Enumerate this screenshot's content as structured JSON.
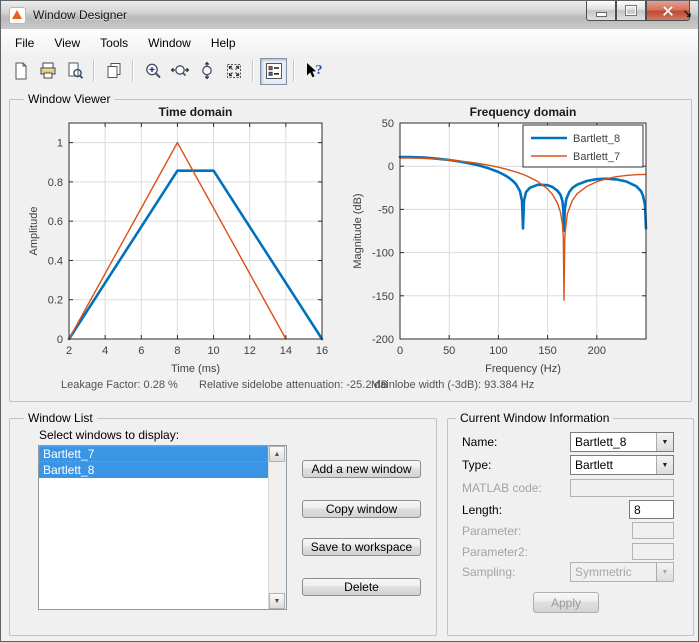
{
  "window": {
    "title": "Window Designer"
  },
  "menu": {
    "items": [
      "File",
      "View",
      "Tools",
      "Window",
      "Help"
    ]
  },
  "toolbar": {
    "icons": [
      "new-document",
      "print",
      "print-preview",
      "copy-window",
      "zoom-in",
      "zoom-x",
      "zoom-y",
      "full-view",
      "legend-toggle",
      "context-help"
    ],
    "pressed": "legend-toggle"
  },
  "window_viewer": {
    "label": "Window Viewer",
    "status": {
      "leakage": "Leakage Factor: 0.28 %",
      "sidelobe": "Relative sidelobe attenuation: -25.2 dB",
      "mainlobe": "Mainlobe width (-3dB): 93.384 Hz"
    }
  },
  "chart_data": [
    {
      "type": "line",
      "title": "Time domain",
      "xlabel": "Time (ms)",
      "ylabel": "Amplitude",
      "xlim": [
        2,
        16
      ],
      "ylim": [
        0,
        1.1
      ],
      "xticks": [
        2,
        4,
        6,
        8,
        10,
        12,
        14,
        16
      ],
      "yticks": [
        0,
        0.2,
        0.4,
        0.6,
        0.8,
        1
      ],
      "grid": true,
      "legend": false,
      "series": [
        {
          "name": "Bartlett_8",
          "color": "#0072BD",
          "width": 2.6,
          "x": [
            2,
            4,
            6,
            8,
            10,
            12,
            14,
            16
          ],
          "y": [
            0,
            0.2857,
            0.5714,
            0.8571,
            0.8571,
            0.5714,
            0.2857,
            0
          ]
        },
        {
          "name": "Bartlett_7",
          "color": "#D95319",
          "width": 1.4,
          "x": [
            2,
            4,
            6,
            8,
            10,
            12,
            14
          ],
          "y": [
            0,
            0.3333,
            0.6667,
            1,
            0.6667,
            0.3333,
            0
          ]
        }
      ]
    },
    {
      "type": "line",
      "title": "Frequency domain",
      "xlabel": "Frequency (Hz)",
      "ylabel": "Magnitude (dB)",
      "xlim": [
        0,
        250
      ],
      "ylim": [
        -200,
        50
      ],
      "xticks": [
        0,
        50,
        100,
        150,
        200
      ],
      "yticks": [
        50,
        0,
        -50,
        -100,
        -150,
        -200
      ],
      "grid": true,
      "legend": true,
      "legend_position": "northeast",
      "series": [
        {
          "name": "Bartlett_8",
          "color": "#0072BD",
          "width": 2.6,
          "x": [
            0,
            10,
            25,
            40,
            50,
            60,
            70,
            80,
            90,
            100,
            105,
            110,
            115,
            118,
            122,
            124,
            125,
            126,
            128,
            132,
            140,
            150,
            155,
            160,
            163,
            165,
            166,
            166.7,
            167.5,
            169,
            172,
            175,
            180,
            190,
            200,
            210,
            220,
            230,
            240,
            245,
            247,
            249,
            250
          ],
          "y": [
            10.7,
            10.6,
            9.9,
            8.5,
            7.2,
            5.6,
            3.5,
            0.9,
            -2.4,
            -6.7,
            -9.5,
            -12.9,
            -17.4,
            -21,
            -29,
            -40,
            -72,
            -40,
            -30,
            -25,
            -21.4,
            -22,
            -24.1,
            -28.3,
            -33,
            -40,
            -50,
            -75,
            -50,
            -38,
            -30,
            -25.4,
            -21.4,
            -17,
            -15.1,
            -14.5,
            -15.3,
            -17.7,
            -23.1,
            -28.9,
            -34,
            -45,
            -72
          ]
        },
        {
          "name": "Bartlett_7",
          "color": "#D95319",
          "width": 1.4,
          "x": [
            0,
            10,
            25,
            40,
            50,
            60,
            70,
            80,
            90,
            100,
            110,
            120,
            125,
            130,
            140,
            150,
            155,
            160,
            163,
            165,
            166,
            166.7,
            167.5,
            168.5,
            170,
            175,
            180,
            190,
            200,
            210,
            220,
            230,
            240,
            250
          ],
          "y": [
            9.5,
            9.45,
            9.0,
            8.05,
            7.2,
            6.1,
            4.7,
            3.1,
            1.2,
            -1.2,
            -4.0,
            -7.5,
            -9.5,
            -11.9,
            -17.7,
            -26.3,
            -32.7,
            -42.7,
            -53,
            -67,
            -82,
            -155,
            -82,
            -70,
            -55.3,
            -39.8,
            -32,
            -23.1,
            -17.9,
            -14.5,
            -12.2,
            -10.7,
            -9.8,
            -9.5
          ]
        }
      ]
    }
  ],
  "window_list": {
    "label": "Window List",
    "select_label": "Select windows to display:",
    "items": [
      {
        "name": "Bartlett_7",
        "selected": true,
        "focused": true
      },
      {
        "name": "Bartlett_8",
        "selected": true,
        "focused": false
      }
    ],
    "buttons": [
      "Add a new window",
      "Copy window",
      "Save to workspace",
      "Delete"
    ]
  },
  "current_window": {
    "label": "Current Window Information",
    "rows": [
      {
        "label": "Name:",
        "value": "Bartlett_8",
        "type": "dropdown",
        "enabled": true
      },
      {
        "label": "Type:",
        "value": "Bartlett",
        "type": "dropdown",
        "enabled": true
      },
      {
        "label": "MATLAB code:",
        "value": "",
        "type": "edit",
        "enabled": false
      },
      {
        "label": "Length:",
        "value": "8",
        "type": "edit",
        "enabled": true
      },
      {
        "label": "Parameter:",
        "value": "",
        "type": "edit",
        "enabled": false
      },
      {
        "label": "Parameter2:",
        "value": "",
        "type": "edit",
        "enabled": false
      },
      {
        "label": "Sampling:",
        "value": "Symmetric",
        "type": "dropdown",
        "enabled": false
      }
    ],
    "apply_label": "Apply"
  },
  "colors": {
    "series_blue": "#0072BD",
    "series_orange": "#D95319",
    "selection_blue": "#3a95e4",
    "close_button_red": "#c04a31"
  }
}
